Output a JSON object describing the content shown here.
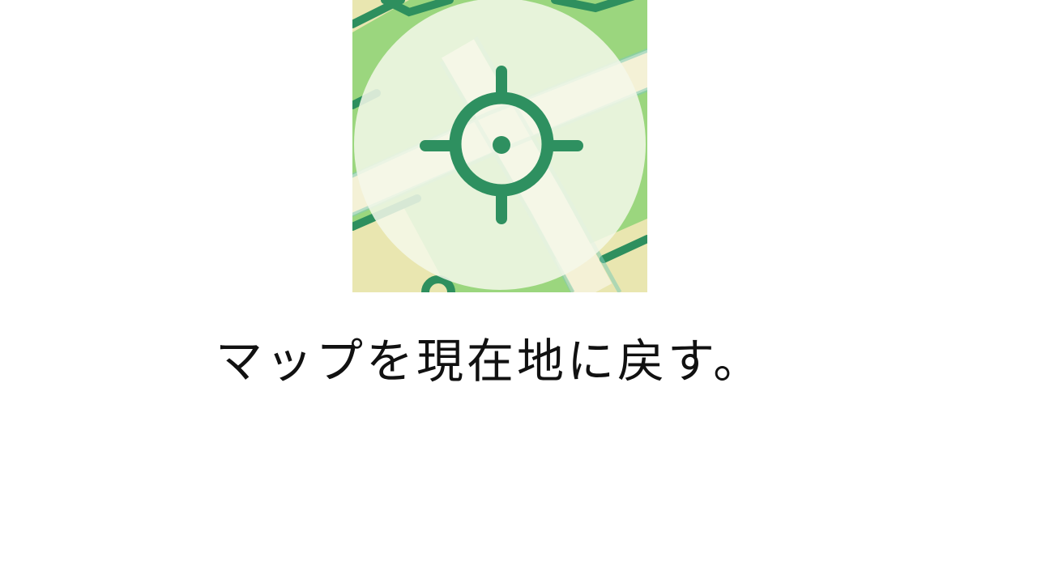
{
  "button": {
    "icon": "crosshair-locate-icon",
    "icon_color": "#2e9060",
    "map_green": "#9bd67e",
    "map_road_dark": "#2e9060",
    "map_road_light": "#f3f0d8",
    "overlay_color": "#f4f8ea"
  },
  "caption": {
    "text": "マップを現在地に戻す。"
  }
}
